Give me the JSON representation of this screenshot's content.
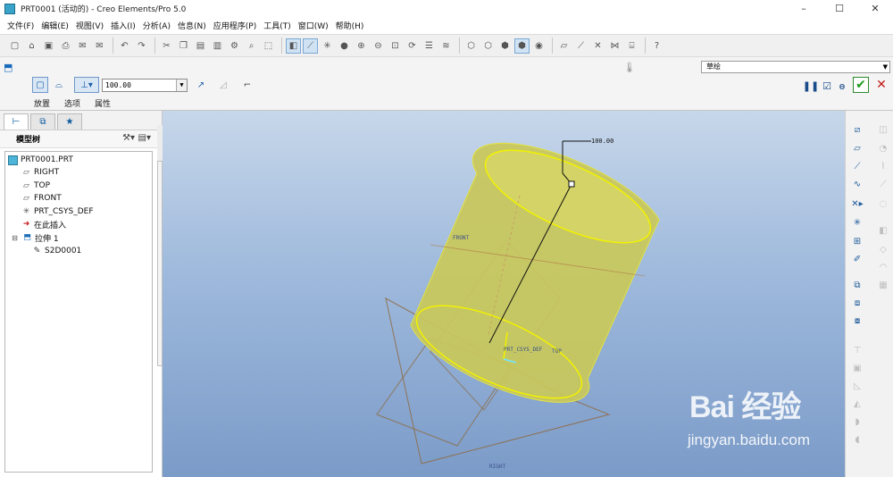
{
  "window": {
    "title": "PRT0001 (活动的) - Creo Elements/Pro 5.0",
    "controls": [
      "–",
      "☐",
      "✕"
    ]
  },
  "menu": [
    "文件(F)",
    "编辑(E)",
    "视图(V)",
    "插入(I)",
    "分析(A)",
    "信息(N)",
    "应用程序(P)",
    "工具(T)",
    "窗口(W)",
    "帮助(H)"
  ],
  "dashboard": {
    "depth_value": "100.00",
    "tabs": [
      "放置",
      "选项",
      "属性"
    ],
    "sketch_filter": "草绘",
    "buttons": {
      "pause": "❚❚",
      "preview_check": "☑",
      "glasses": "ɵ",
      "ok": "✔",
      "cancel": "✕"
    }
  },
  "model_tree": {
    "header": "模型树",
    "items": [
      {
        "label": "PRT0001.PRT",
        "icon": "part-icon"
      },
      {
        "label": "RIGHT",
        "icon": "datum-plane-icon"
      },
      {
        "label": "TOP",
        "icon": "datum-plane-icon"
      },
      {
        "label": "FRONT",
        "icon": "datum-plane-icon"
      },
      {
        "label": "PRT_CSYS_DEF",
        "icon": "csys-icon"
      },
      {
        "label": "在此插入",
        "icon": "insert-here-icon"
      },
      {
        "label": "拉伸 1",
        "icon": "extrude-icon"
      },
      {
        "label": "S2D0001",
        "icon": "sketch-icon"
      }
    ]
  },
  "viewport": {
    "dimension_label": "100.00",
    "datum_labels": {
      "front": "FRONT",
      "top": "TOP",
      "csys": "PRT_CSYS_DEF",
      "right": "RIGHT"
    }
  },
  "watermark": {
    "brand": "Bai 经验",
    "url": "jingyan.baidu.com"
  },
  "colors": {
    "model_fill": "#c9c85a",
    "model_edge": "#f2f200",
    "datum_plane": "#9a6a3c",
    "accent": "#1d5a9a",
    "ok_green": "#1d9a1d"
  }
}
